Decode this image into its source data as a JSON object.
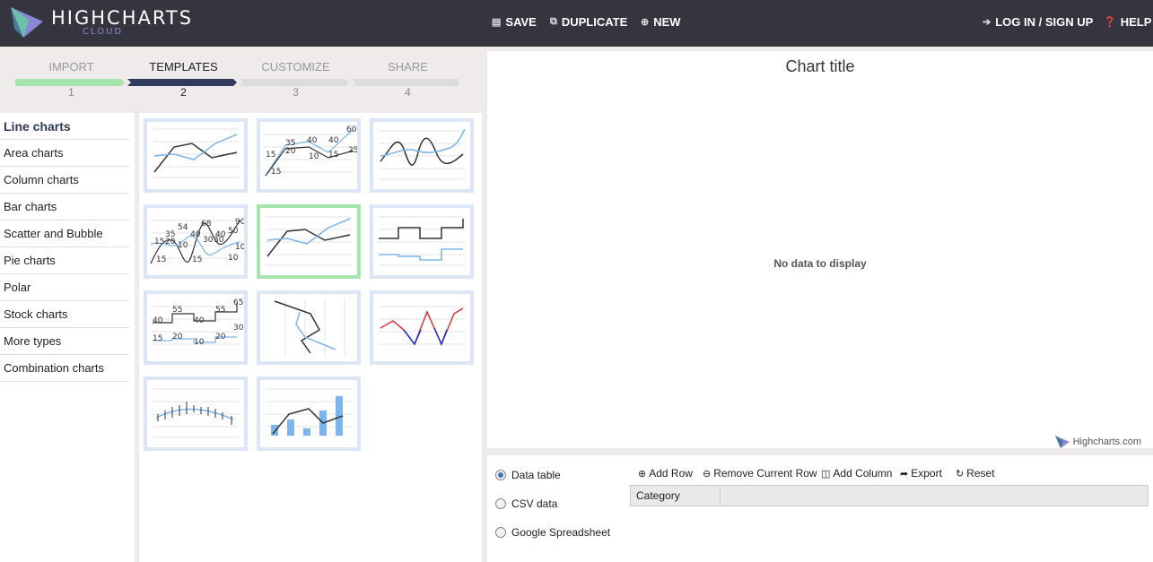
{
  "app": {
    "logo_text": "HIGHCHARTS",
    "logo_sub": "CLOUD"
  },
  "topnav": {
    "save": "SAVE",
    "duplicate": "DUPLICATE",
    "new": "NEW",
    "login": "LOG IN / SIGN UP",
    "help": "HELP"
  },
  "steps": [
    {
      "label": "IMPORT",
      "num": "1",
      "color": "#a6e5ae"
    },
    {
      "label": "TEMPLATES",
      "num": "2",
      "color": "#2f3a5c"
    },
    {
      "label": "CUSTOMIZE",
      "num": "3",
      "color": "#dcdcdc"
    },
    {
      "label": "SHARE",
      "num": "4",
      "color": "#dcdcdc"
    }
  ],
  "categories": [
    "Line charts",
    "Area charts",
    "Column charts",
    "Bar charts",
    "Scatter and Bubble",
    "Pie charts",
    "Polar",
    "Stock charts",
    "More types",
    "Combination charts"
  ],
  "templates": {
    "labels_t2": [
      "60",
      "35",
      "40",
      "40",
      "15",
      "20",
      "10",
      "15",
      "25",
      "15"
    ],
    "labels_t4": [
      "54",
      "68",
      "90",
      "35",
      "40",
      "40",
      "50",
      "15",
      "20",
      "10",
      "30",
      "30",
      "10",
      "15",
      "15",
      "10"
    ],
    "labels_t7": [
      "65",
      "55",
      "55",
      "40",
      "40",
      "30",
      "15",
      "20",
      "20",
      "10"
    ]
  },
  "chart": {
    "title": "Chart title",
    "nodata": "No data to display",
    "credit": "Highcharts.com"
  },
  "data": {
    "sources": [
      "Data table",
      "CSV data",
      "Google Spreadsheet"
    ],
    "tools": {
      "add_row": "Add Row",
      "remove_row": "Remove Current Row",
      "add_column": "Add Column",
      "export": "Export",
      "reset": "Reset"
    },
    "grid_header": "Category"
  },
  "colors": {
    "topbar": "#34353f",
    "accent_green": "#a6e5ae",
    "accent_navy": "#2f3a5c",
    "series_dark": "#333333",
    "series_blue": "#7cb5ec"
  }
}
